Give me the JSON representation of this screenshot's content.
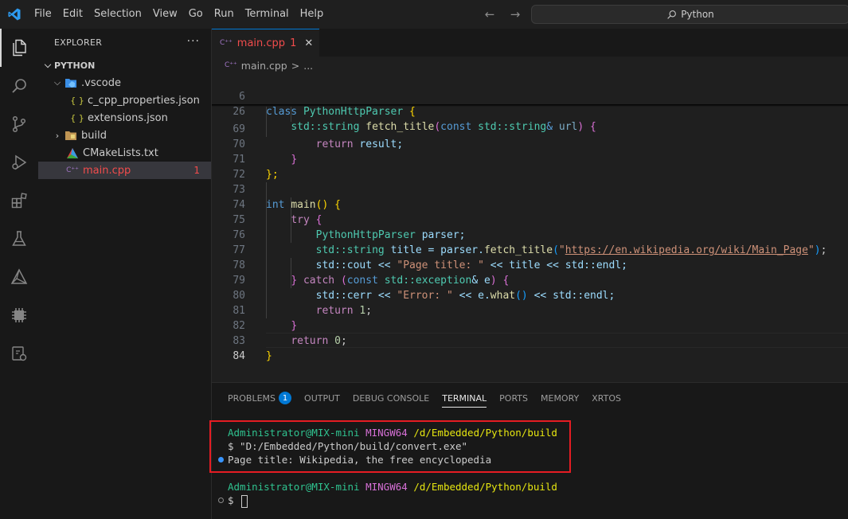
{
  "titlebar": {
    "menu": [
      "File",
      "Edit",
      "Selection",
      "View",
      "Go",
      "Run",
      "Terminal",
      "Help"
    ],
    "search_text": "Python"
  },
  "activitybar": {
    "items": [
      "explorer-icon",
      "search-icon",
      "source-control-icon",
      "run-debug-icon",
      "extensions-icon",
      "testing-icon",
      "cmake-icon",
      "chip-icon",
      "remote-explorer-icon"
    ]
  },
  "sidebar": {
    "header": "EXPLORER",
    "more": "···",
    "root": "PYTHON",
    "items": [
      {
        "label": ".vscode",
        "kind": "folder-open"
      },
      {
        "label": "c_cpp_properties.json",
        "kind": "json"
      },
      {
        "label": "extensions.json",
        "kind": "json"
      },
      {
        "label": "build",
        "kind": "folder"
      },
      {
        "label": "CMakeLists.txt",
        "kind": "cmake"
      },
      {
        "label": "main.cpp",
        "kind": "cpp",
        "badge": "1"
      }
    ],
    "json_icon_text": "{ }",
    "cpp_icon_text": "C⁺⁺"
  },
  "editor": {
    "tab": {
      "label": "main.cpp",
      "count": "1",
      "close": "✕",
      "icon": "C⁺⁺"
    },
    "breadcrumb": {
      "file": "main.cpp",
      "sep": ">",
      "rest": "..."
    },
    "line_numbers": [
      "6",
      "26",
      "69",
      "70",
      "71",
      "72",
      "73",
      "74",
      "75",
      "76",
      "77",
      "78",
      "79",
      "80",
      "81",
      "82",
      "83",
      "84"
    ],
    "code": {
      "l6_class": "class",
      "l6_name": "PythonHttpParser",
      "l6_brace": "{",
      "l26_ns": "std::",
      "l26_type": "string",
      "l26_fn": "fetch_title",
      "l26_open": "(",
      "l26_const": "const",
      "l26_ns2": "std::",
      "l26_type2": "string",
      "l26_amp": "&",
      "l26_param": "url",
      "l26_close": ")",
      "l26_brace": "{",
      "l69_ret": "return",
      "l69_rest": "result;",
      "l70": "}",
      "l71": "};",
      "l73_int": "int",
      "l73_fn": "main",
      "l73_parens": "()",
      "l73_brace": "{",
      "l74_try": "try",
      "l74_brace": "{",
      "l75_type": "PythonHttpParser",
      "l75_rest": "parser;",
      "l76_ns": "std::",
      "l76_type": "string",
      "l76_mid": "title = parser.",
      "l76_fn": "fetch_title",
      "l76_open": "(",
      "l76_q1": "\"",
      "l76_url": "https://en.wikipedia.org/wiki/Main_Page",
      "l76_q2": "\"",
      "l76_close": ")",
      "l76_end": ";",
      "l77_a": "std::cout << ",
      "l77_str": "\"Page title: \"",
      "l77_b": " << title << std::endl;",
      "l78_brace": "}",
      "l78_catch": "catch",
      "l78_open": "(",
      "l78_const": "const",
      "l78_ns": "std::",
      "l78_type": "exception",
      "l78_amp": "& e",
      "l78_close": ")",
      "l78_brace2": "{",
      "l79_a": "std::cerr << ",
      "l79_str": "\"Error: \"",
      "l79_b": " << e.",
      "l79_fn": "what",
      "l79_parens": "()",
      "l79_c": " << std::endl;",
      "l80_ret": "return",
      "l80_num": "1",
      "l80_end": ";",
      "l81": "}",
      "l82_ret": "return",
      "l82_num": "0",
      "l82_end": ";",
      "l83": "}"
    }
  },
  "panel": {
    "tabs": [
      "PROBLEMS",
      "OUTPUT",
      "DEBUG CONSOLE",
      "TERMINAL",
      "PORTS",
      "MEMORY",
      "XRTOS"
    ],
    "problems_count": "1",
    "active_tab": "TERMINAL",
    "terminal": {
      "user": "Administrator@MIX-mini",
      "env": "MINGW64",
      "path": "/d/Embedded/Python/build",
      "command": "$ \"D:/Embedded/Python/build/convert.exe\"",
      "output": "Page title: Wikipedia, the free encyclopedia",
      "prompt": "$"
    }
  },
  "colors": {
    "accent": "#0078d4",
    "error": "#f14c4c",
    "highlight_box": "#e51c23"
  }
}
